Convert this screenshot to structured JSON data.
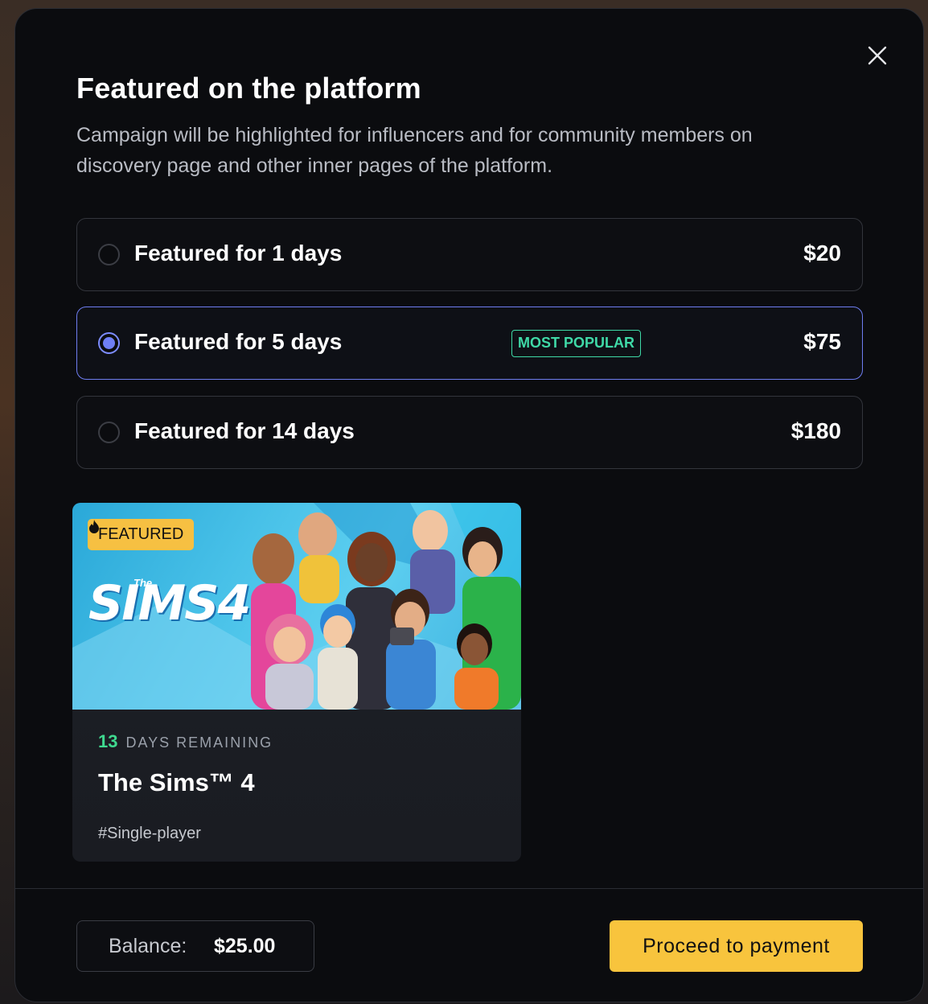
{
  "modal": {
    "title": "Featured on the platform",
    "subtitle": "Campaign will be highlighted for influencers and for community members on discovery page and other inner pages of the platform."
  },
  "options": [
    {
      "label": "Featured for 1 days",
      "price": "$20",
      "selected": false
    },
    {
      "label": "Featured for 5 days",
      "price": "$75",
      "selected": true,
      "badge": "MOST POPULAR"
    },
    {
      "label": "Featured for 14 days",
      "price": "$180",
      "selected": false
    }
  ],
  "card": {
    "badge": "FEATURED",
    "logo_text": "SIMS4",
    "logo_prefix": "The",
    "days_number": "13",
    "days_label": "DAYS REMAINING",
    "title": "The Sims™ 4",
    "tag": "#Single-player"
  },
  "footer": {
    "balance_label": "Balance:",
    "balance_value": "$25.00",
    "proceed_label": "Proceed to payment"
  },
  "colors": {
    "accent_yellow": "#f8c43d",
    "selected_border": "#6e7df0",
    "popular_green": "#3fd9a7",
    "days_green": "#3fd98f"
  }
}
